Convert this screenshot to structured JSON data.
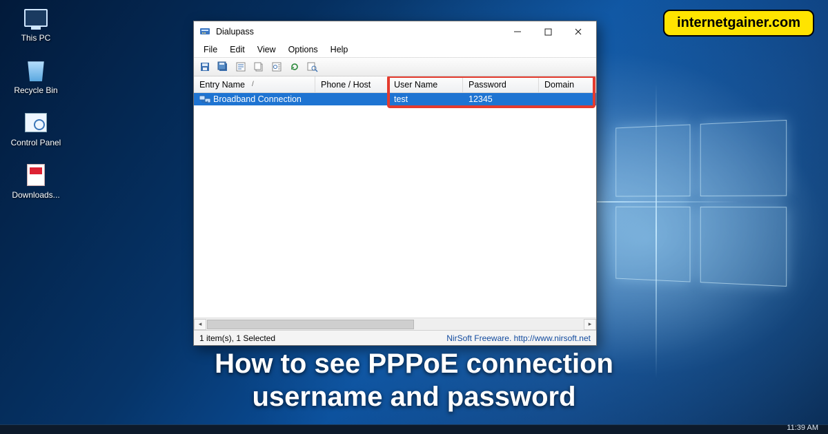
{
  "desktop": {
    "icons": [
      {
        "label": "This PC"
      },
      {
        "label": "Recycle Bin"
      },
      {
        "label": "Control Panel"
      },
      {
        "label": "Downloads..."
      }
    ]
  },
  "watermark": "internetgainer.com",
  "caption_line1": "How to see PPPoE connection",
  "caption_line2": "username and password",
  "taskbar": {
    "clock": "11:39 AM"
  },
  "app": {
    "title": "Dialupass",
    "menus": [
      "File",
      "Edit",
      "View",
      "Options",
      "Help"
    ],
    "columns": {
      "entry": "Entry Name",
      "phone": "Phone / Host",
      "user": "User Name",
      "pass": "Password",
      "domain": "Domain"
    },
    "rows": [
      {
        "entry": "Broadband Connection",
        "phone": "",
        "user": "test",
        "pass": "12345",
        "domain": ""
      }
    ],
    "status_left": "1 item(s), 1 Selected",
    "status_right_text": "NirSoft Freeware.  ",
    "status_right_link": "http://www.nirsoft.net"
  }
}
